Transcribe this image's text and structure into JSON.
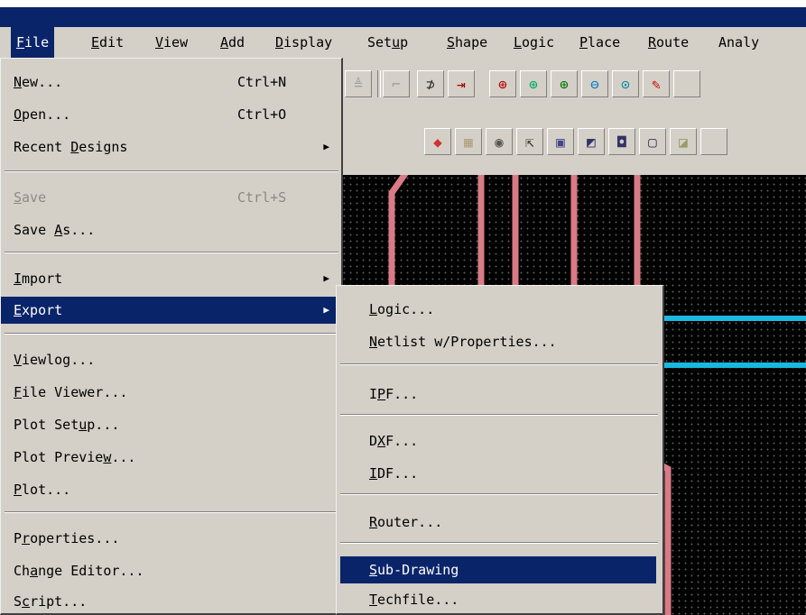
{
  "menubar": {
    "items": [
      {
        "u": "F",
        "rest": "ile"
      },
      {
        "u": "E",
        "rest": "dit"
      },
      {
        "u": "V",
        "rest": "iew"
      },
      {
        "u": "A",
        "rest": "dd"
      },
      {
        "u": "D",
        "rest": "isplay"
      },
      {
        "pre": "Set",
        "u": "u",
        "rest": "p"
      },
      {
        "u": "S",
        "rest": "hape"
      },
      {
        "u": "L",
        "rest": "ogic"
      },
      {
        "u": "P",
        "rest": "lace"
      },
      {
        "u": "R",
        "rest": "oute"
      },
      {
        "pre": "Analy",
        "u": "",
        "rest": ""
      }
    ]
  },
  "file_menu": {
    "new": {
      "u": "N",
      "rest": "ew...",
      "shortcut": "Ctrl+N"
    },
    "open": {
      "u": "O",
      "rest": "pen...",
      "shortcut": "Ctrl+O"
    },
    "recent": {
      "pre": "Recent ",
      "u": "D",
      "rest": "esigns"
    },
    "save": {
      "u": "S",
      "rest": "ave",
      "shortcut": "Ctrl+S"
    },
    "save_as": {
      "pre": "Save ",
      "u": "A",
      "rest": "s..."
    },
    "import": {
      "u": "I",
      "rest": "mport"
    },
    "export": {
      "u": "E",
      "rest": "xport"
    },
    "viewlog": {
      "u": "V",
      "rest": "iewlog..."
    },
    "file_viewer": {
      "u": "F",
      "rest": "ile Viewer..."
    },
    "plot_setup": {
      "pre": "Plot Set",
      "u": "u",
      "rest": "p..."
    },
    "plot_preview": {
      "pre": "Plot Previe",
      "u": "w",
      "rest": "..."
    },
    "plot": {
      "u": "P",
      "rest": "lot..."
    },
    "properties": {
      "pre": "P",
      "u": "r",
      "rest": "operties..."
    },
    "change_editor": {
      "pre": "Ch",
      "u": "a",
      "rest": "nge Editor..."
    },
    "script": {
      "pre": "S",
      "u": "c",
      "rest": "ript..."
    }
  },
  "export_menu": {
    "logic": {
      "u": "L",
      "rest": "ogic..."
    },
    "netlist": {
      "u": "N",
      "rest": "etlist w/Properties..."
    },
    "ipf": {
      "pre": "I",
      "u": "P",
      "rest": "F..."
    },
    "dxf": {
      "pre": "D",
      "u": "X",
      "rest": "F..."
    },
    "idf": {
      "u": "I",
      "rest": "DF..."
    },
    "router": {
      "u": "R",
      "rest": "outer..."
    },
    "sub_drawing": {
      "u": "S",
      "rest": "ub-Drawing"
    },
    "techfile": {
      "u": "T",
      "rest": "echfile..."
    }
  },
  "toolbar_icons": {
    "row1": [
      "undo-icon",
      "redo-icon",
      "pin-icon",
      "connect-icon",
      "zoom-points-icon",
      "zoom-fit-icon",
      "zoom-in-icon",
      "zoom-out-icon",
      "zoom-world-icon",
      "highlight-icon"
    ],
    "row2": [
      "shape-icon",
      "pad-icon",
      "via-icon",
      "pointer-icon",
      "layer-icon",
      "select-area-icon",
      "frame-icon",
      "outline-icon",
      "fill-icon"
    ]
  },
  "colors": {
    "highlight": "#0a246a",
    "menu_bg": "#d4d0c8",
    "trace_pink": "#d97b86",
    "trace_cyan": "#19b8e0"
  }
}
